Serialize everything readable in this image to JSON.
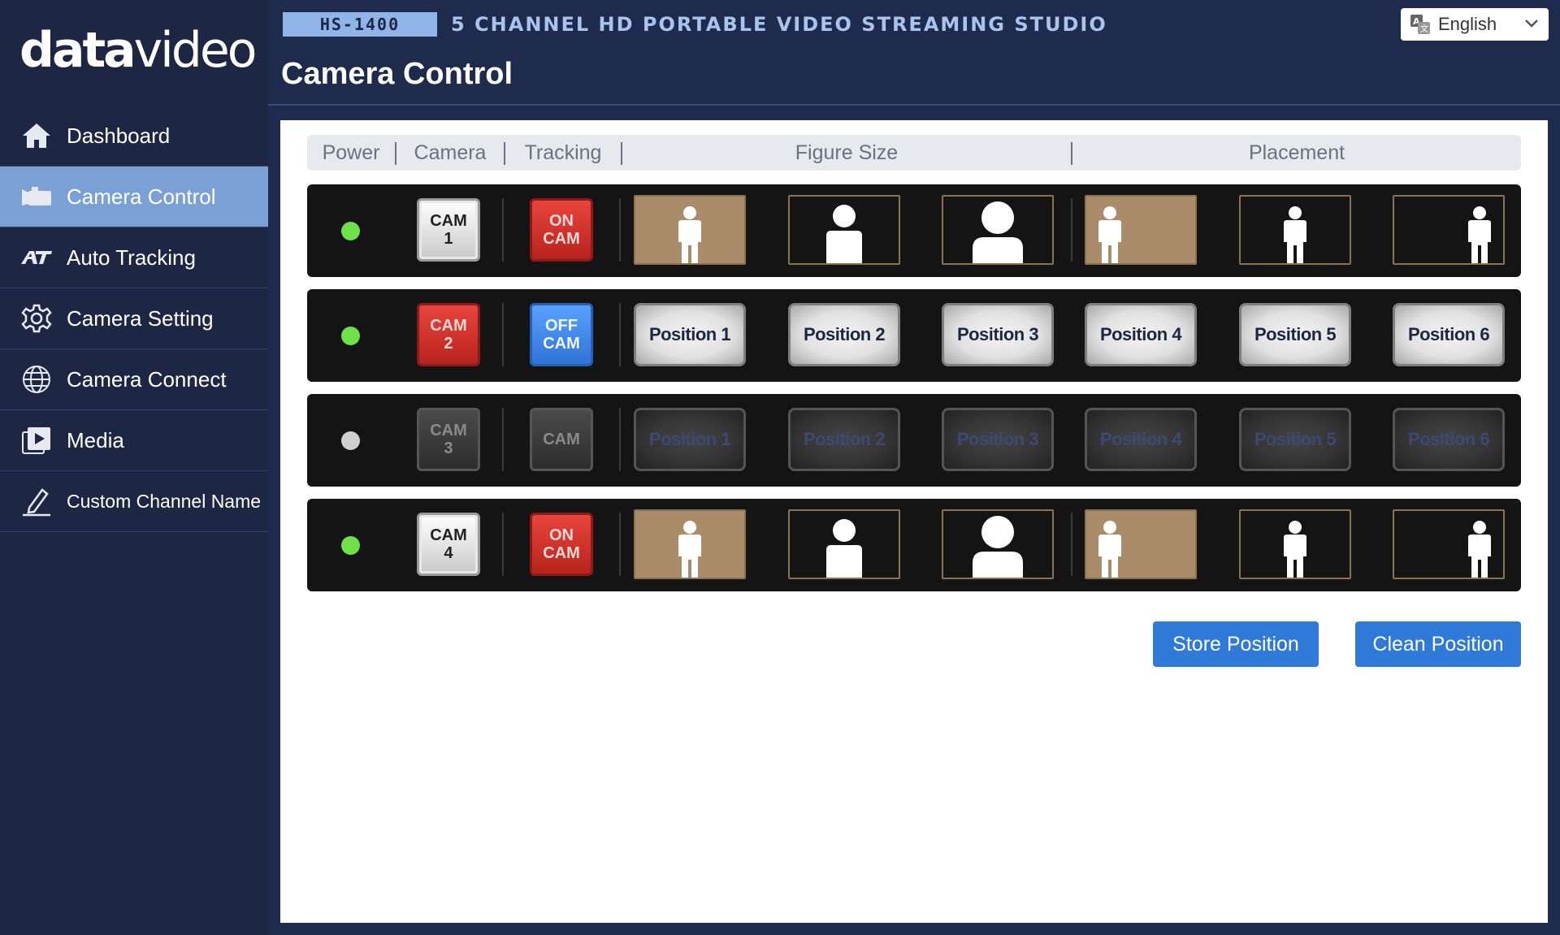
{
  "brand": {
    "logo_light": "data",
    "logo_bold": "video"
  },
  "sidebar": {
    "items": [
      {
        "label": "Dashboard",
        "icon": "home-icon"
      },
      {
        "label": "Camera Control",
        "icon": "camera-icon",
        "active": true
      },
      {
        "label": "Auto Tracking",
        "icon": "at-icon"
      },
      {
        "label": "Camera Setting",
        "icon": "gear-icon"
      },
      {
        "label": "Camera Connect",
        "icon": "globe-icon"
      },
      {
        "label": "Media",
        "icon": "media-play-icon"
      },
      {
        "label": "Custom Channel Name",
        "icon": "pencil-icon"
      }
    ]
  },
  "header": {
    "model": "HS-1400",
    "studio_title": "5 CHANNEL HD PORTABLE VIDEO STREAMING STUDIO",
    "page_title": "Camera Control",
    "language": "English"
  },
  "columns": {
    "power": "Power",
    "camera": "Camera",
    "tracking": "Tracking",
    "figure_size": "Figure Size",
    "placement": "Placement"
  },
  "rows": [
    {
      "power": "on",
      "camera": "CAM\n1",
      "camera_style": "white",
      "tracking": "ON\nCAM",
      "tracking_style": "red",
      "mode": "figures",
      "figure_selected": 0,
      "placement_selected": 0
    },
    {
      "power": "on",
      "camera": "CAM\n2",
      "camera_style": "red",
      "tracking": "OFF\nCAM",
      "tracking_style": "blue",
      "mode": "positions",
      "positions": [
        "Position 1",
        "Position 2",
        "Position 3",
        "Position 4",
        "Position 5",
        "Position 6"
      ],
      "positions_style": "light"
    },
    {
      "power": "off",
      "camera": "CAM\n3",
      "camera_style": "dark",
      "tracking": "CAM",
      "tracking_style": "dark",
      "mode": "positions",
      "positions": [
        "Position 1",
        "Position 2",
        "Position 3",
        "Position 4",
        "Position 5",
        "Position 6"
      ],
      "positions_style": "dark"
    },
    {
      "power": "on",
      "camera": "CAM\n4",
      "camera_style": "white",
      "tracking": "ON\nCAM",
      "tracking_style": "red",
      "mode": "figures",
      "figure_selected": 0,
      "placement_selected": 0
    }
  ],
  "actions": {
    "store": "Store Position",
    "clean": "Clean Position"
  },
  "colors": {
    "accent": "#2f7ad8",
    "sidebar_active": "#7ba0d6",
    "power_on": "#6ee048",
    "figure_selected": "#ab8c6a"
  }
}
